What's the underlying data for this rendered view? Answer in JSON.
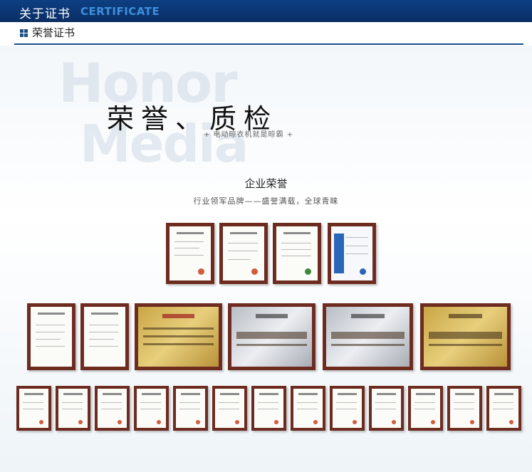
{
  "header": {
    "title_cn": "关于证书",
    "title_en": "CERTIFICATE"
  },
  "subheader": {
    "label": "荣誉证书"
  },
  "banner": {
    "watermark_line1": "Honor",
    "watermark_line2": "Media",
    "title": "荣誉、质检",
    "tagline": "+ 电动晾衣机就是晾霸 +"
  },
  "section": {
    "title": "企业荣誉",
    "subtitle": "行业领军品牌——盛誉满载，全球青睐"
  },
  "colors": {
    "header_bg": "#0a2f66",
    "accent_blue": "#3e8fdc",
    "frame": "#6e2c20",
    "rule": "#1b4f86"
  }
}
